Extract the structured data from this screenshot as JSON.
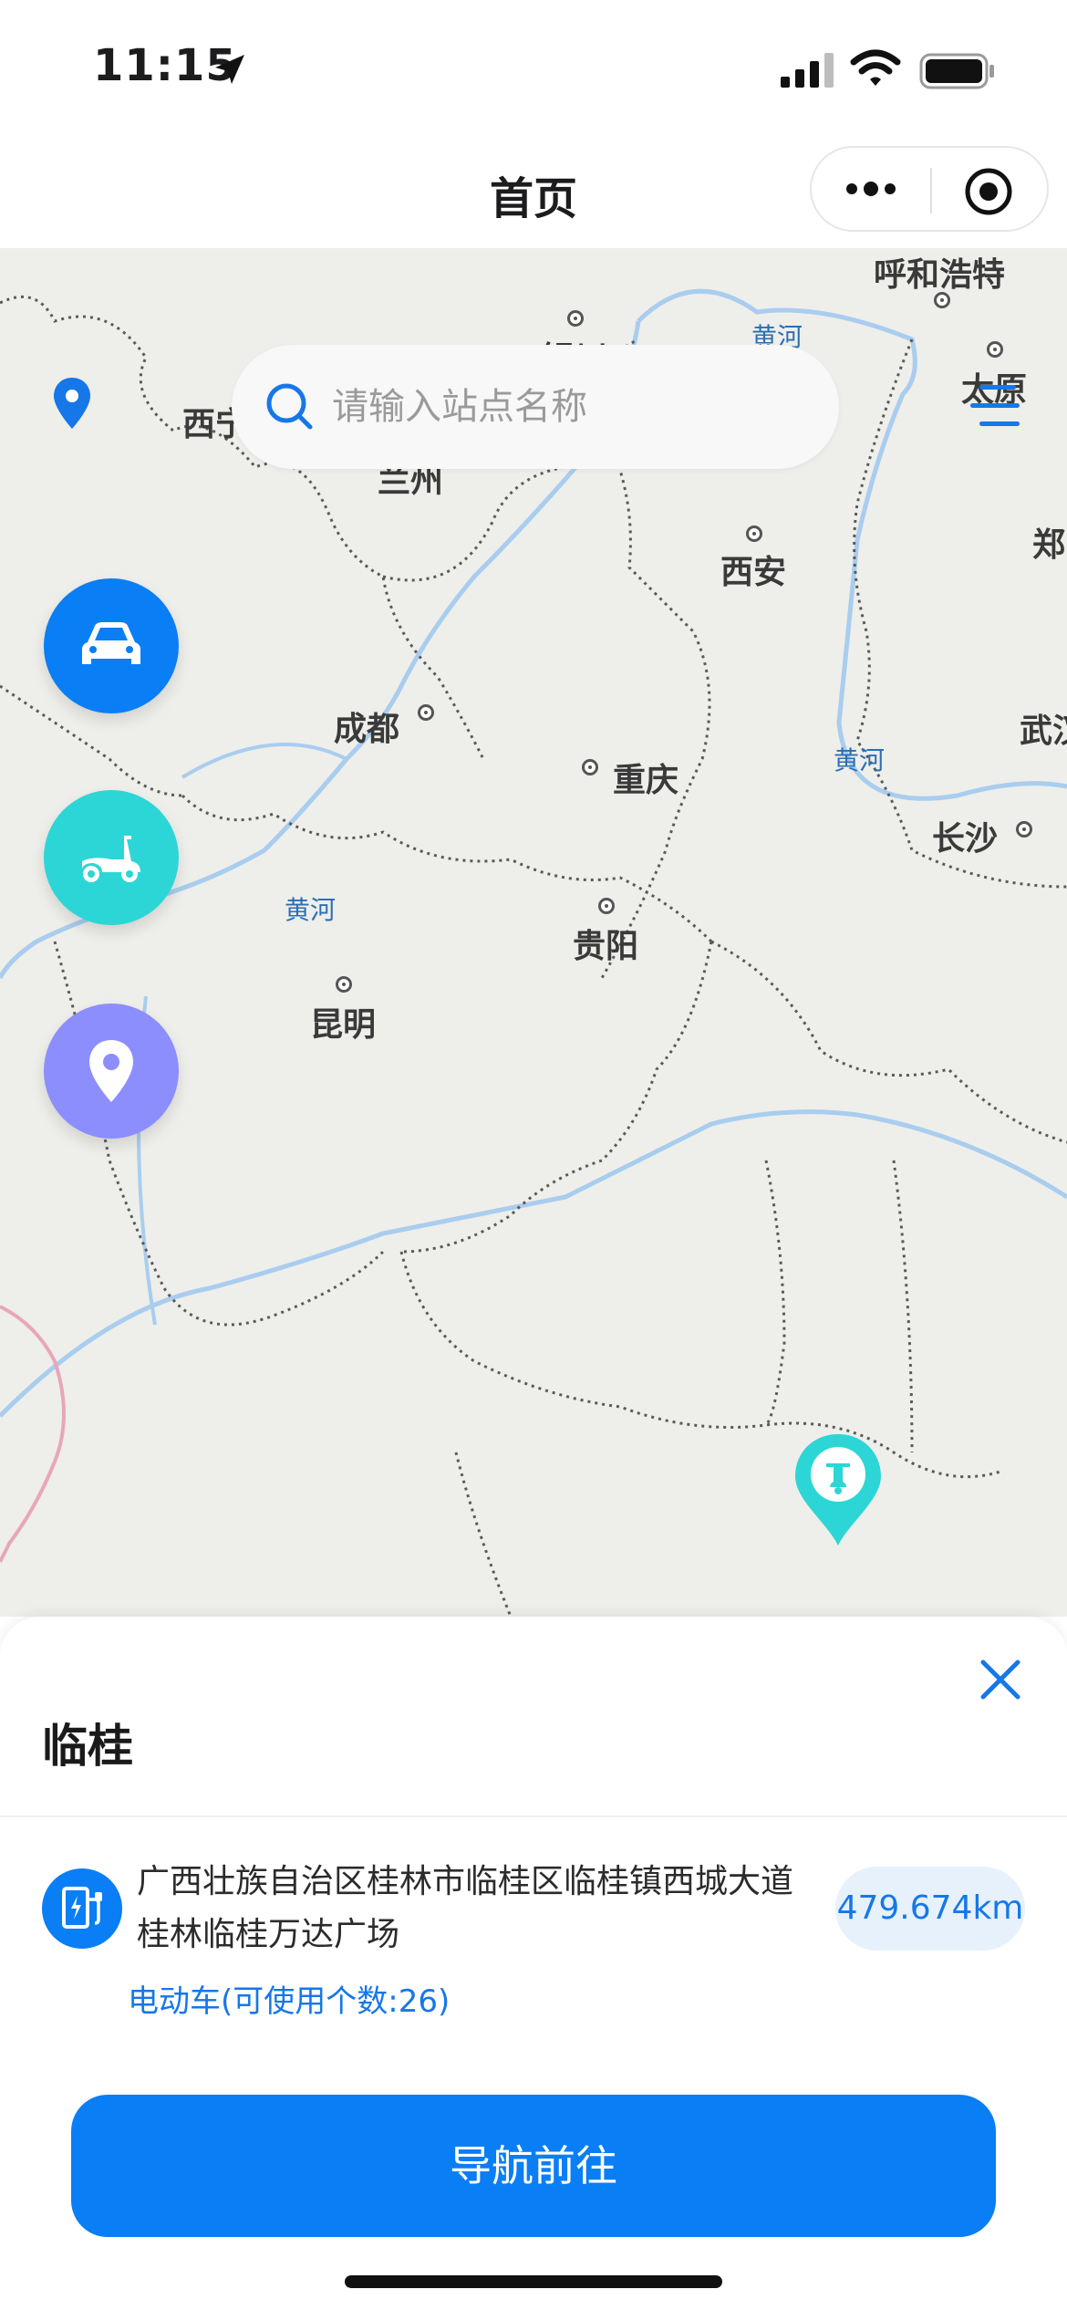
{
  "status_bar": {
    "time": "11:15"
  },
  "nav": {
    "title": "首页"
  },
  "search": {
    "placeholder": "请输入站点名称"
  },
  "map": {
    "cities": [
      {
        "name": "呼和浩特"
      },
      {
        "name": "银川"
      },
      {
        "name": "太原"
      },
      {
        "name": "西宁"
      },
      {
        "name": "兰州"
      },
      {
        "name": "西安"
      },
      {
        "name": "郑"
      },
      {
        "name": "成都"
      },
      {
        "name": "武汉"
      },
      {
        "name": "重庆"
      },
      {
        "name": "长沙"
      },
      {
        "name": "贵阳"
      },
      {
        "name": "昆明"
      }
    ],
    "rivers": [
      "黄河",
      "黄河",
      "黄河"
    ]
  },
  "sheet": {
    "title": "临桂",
    "address": "广西壮族自治区桂林市临桂区临桂镇西城大道桂林临桂万达广场",
    "vehicle_info": "电动车(可使用个数:26)",
    "distance": "479.674km",
    "navigate_label": "导航前往"
  },
  "colors": {
    "primary": "#0a7ef5",
    "scooter": "#2cd6d6",
    "pin": "#8b8efc",
    "map_bg": "#eeeeea"
  }
}
